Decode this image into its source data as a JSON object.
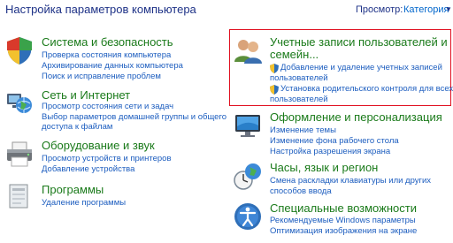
{
  "header": {
    "title": "Настройка параметров компьютера",
    "view_by_label": "Просмотр:",
    "view_by_value": "Категория"
  },
  "left": [
    {
      "title": "Система и безопасность",
      "icon": "shield-flag-icon",
      "links": [
        "Проверка состояния компьютера",
        "Архивирование данных компьютера",
        "Поиск и исправление проблем"
      ]
    },
    {
      "title": "Сеть и Интернет",
      "icon": "network-globe-icon",
      "links": [
        "Просмотр состояния сети и задач",
        "Выбор параметров домашней группы и общего",
        "доступа к файлам"
      ]
    },
    {
      "title": "Оборудование и звук",
      "icon": "printer-icon",
      "links": [
        "Просмотр устройств и принтеров",
        "Добавление устройства"
      ]
    },
    {
      "title": "Программы",
      "icon": "programs-icon",
      "links": [
        "Удаление программы"
      ]
    }
  ],
  "right": [
    {
      "title_line1": "Учетные записи пользователей и",
      "title_line2": "семейн...",
      "icon": "users-icon",
      "links": [
        {
          "line1": "Добавление и удаление учетных записей",
          "line2": "пользователей"
        },
        {
          "line1": "Установка родительского контроля для всех",
          "line2": "пользователей"
        }
      ]
    },
    {
      "title": "Оформление и персонализация",
      "icon": "monitor-icon",
      "links": [
        "Изменение темы",
        "Изменение фона рабочего стола",
        "Настройка разрешения экрана"
      ]
    },
    {
      "title": "Часы, язык и регион",
      "icon": "clock-globe-icon",
      "links": [
        "Смена раскладки клавиатуры или других",
        "способов ввода"
      ]
    },
    {
      "title": "Специальные возможности",
      "icon": "accessibility-icon",
      "links": [
        "Рекомендуемые Windows параметры",
        "Оптимизация изображения на экране"
      ]
    }
  ]
}
